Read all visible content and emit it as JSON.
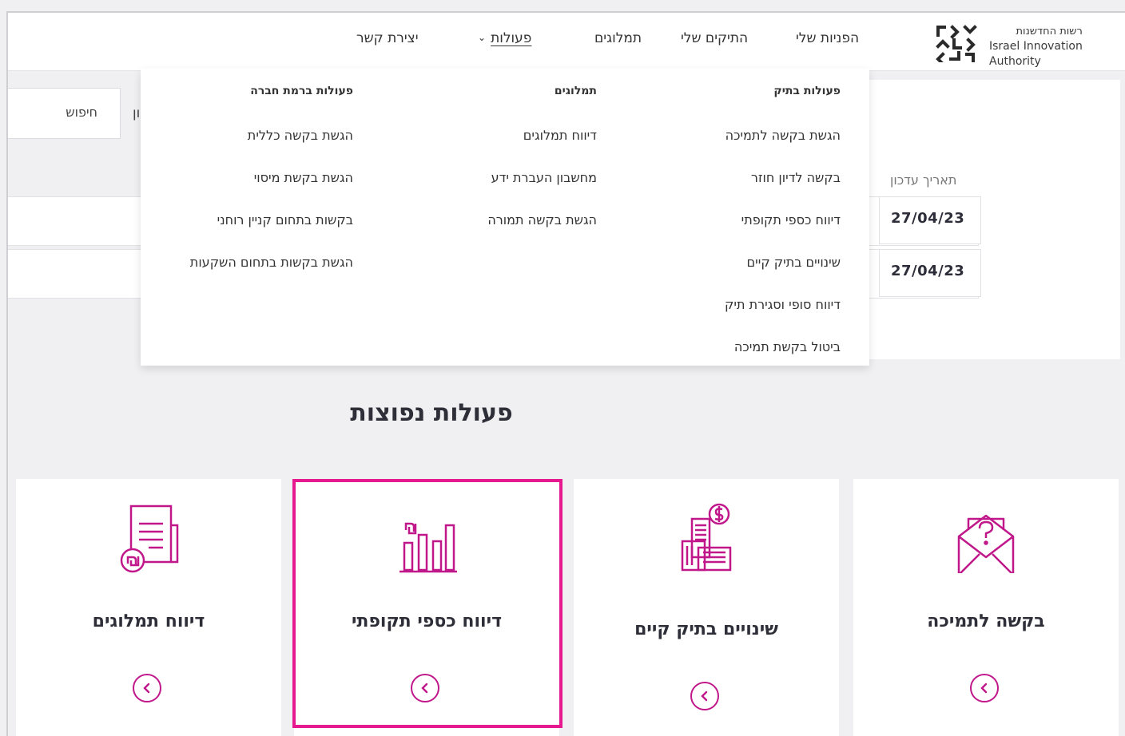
{
  "colors": {
    "accent": "#c0188a",
    "highlight": "#e6198f"
  },
  "brand": {
    "name_he": "רשות החדשנות",
    "name_en_1": "Israel Innovation",
    "name_en_2": "Authority",
    "logo_icon": "innovation-authority-logo"
  },
  "nav": {
    "items": [
      {
        "label": "הפניות שלי"
      },
      {
        "label": "התיקים שלי"
      },
      {
        "label": "תמלוגים"
      },
      {
        "label": "פעולות",
        "active": true
      },
      {
        "label": "יצירת קשר"
      }
    ]
  },
  "background": {
    "search_label": "חיפוש",
    "search_fragment": "ון",
    "date_header": "תאריך עדכון",
    "dates": [
      "27/04/23",
      "27/04/23"
    ]
  },
  "dropdown": {
    "columns": [
      {
        "header": "פעולות בתיק",
        "items": [
          "הגשת בקשה לתמיכה",
          "בקשה לדיון חוזר",
          "דיווח כספי תקופתי",
          "שינויים בתיק קיים",
          "דיווח סופי וסגירת תיק",
          "ביטול בקשת תמיכה"
        ]
      },
      {
        "header": "תמלוגים",
        "items": [
          "דיווח תמלוגים",
          "מחשבון העברת ידע",
          "הגשת בקשה תמורה"
        ]
      },
      {
        "header": "פעולות ברמת חברה",
        "items": [
          "הגשת בקשה כללית",
          "הגשת בקשת מיסוי",
          "בקשות בתחום קניין רוחני",
          "הגשת בקשות בתחום השקעות"
        ]
      }
    ]
  },
  "popular": {
    "title": "פעולות נפוצות",
    "cards": [
      {
        "title": "בקשה לתמיכה",
        "icon": "envelope-question-icon"
      },
      {
        "title": "שינויים בתיק קיים",
        "icon": "buildings-dollar-icon"
      },
      {
        "title": "דיווח כספי תקופתי",
        "icon": "bar-chart-shekel-icon",
        "highlighted": true
      },
      {
        "title": "דיווח תמלוגים",
        "icon": "document-shekel-icon"
      }
    ]
  }
}
